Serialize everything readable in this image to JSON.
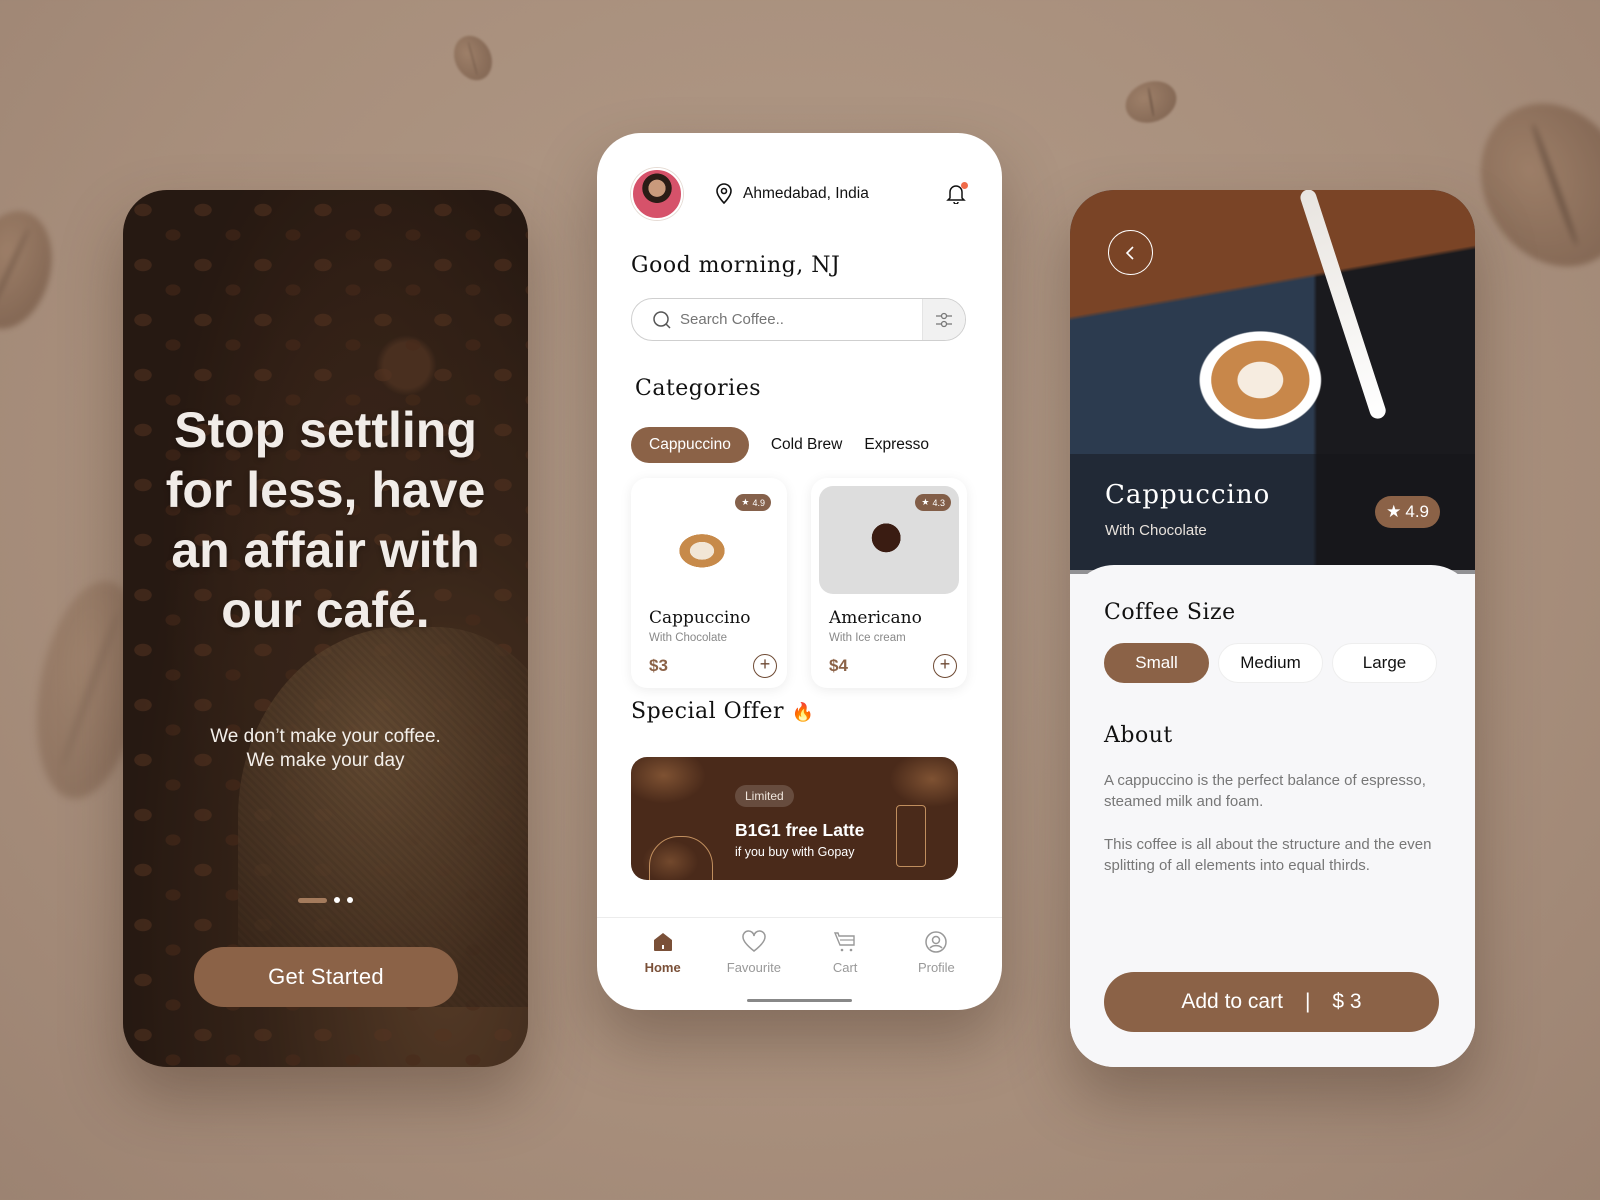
{
  "onboarding": {
    "headline": "Stop settling for less, have an affair with our café.",
    "tagline_line1": "We don’t make your coffee.",
    "tagline_line2": "We make your day",
    "pager": {
      "total": 3,
      "active": 1
    },
    "cta_label": "Get Started"
  },
  "home": {
    "location": "Ahmedabad, India",
    "greeting": "Good morning, NJ",
    "search": {
      "placeholder": "Search Coffee.."
    },
    "categories_title": "Categories",
    "categories": [
      {
        "label": "Cappuccino",
        "active": true
      },
      {
        "label": "Cold Brew",
        "active": false
      },
      {
        "label": "Expresso",
        "active": false
      }
    ],
    "products": [
      {
        "name": "Cappuccino",
        "subtitle": "With Chocolate",
        "price": "$3",
        "rating": "4.9"
      },
      {
        "name": "Americano",
        "subtitle": "With Ice cream",
        "price": "$4",
        "rating": "4.3"
      }
    ],
    "special_offer_title": "Special Offer",
    "special_offer_emoji": "🔥",
    "offer": {
      "badge": "Limited",
      "title": "B1G1 free Latte",
      "subtitle": "if you buy with Gopay"
    },
    "tabs": [
      {
        "label": "Home",
        "icon": "home-icon",
        "active": true
      },
      {
        "label": "Favourite",
        "icon": "heart-icon",
        "active": false
      },
      {
        "label": "Cart",
        "icon": "cart-icon",
        "active": false
      },
      {
        "label": "Profile",
        "icon": "profile-icon",
        "active": false
      }
    ]
  },
  "detail": {
    "title": "Cappuccino",
    "subtitle": "With Chocolate",
    "rating": "4.9",
    "size_title": "Coffee Size",
    "sizes": [
      {
        "label": "Small",
        "active": true
      },
      {
        "label": "Medium",
        "active": false
      },
      {
        "label": "Large",
        "active": false
      }
    ],
    "about_title": "About",
    "about_p1": "A cappuccino is the perfect balance of espresso, steamed milk and foam.",
    "about_p2": "This coffee is all about the structure and the even splitting of all elements into equal thirds.",
    "cart_label": "Add to cart",
    "cart_separator": "|",
    "cart_price": "$ 3"
  },
  "colors": {
    "accent": "#8b6247",
    "background": "#a88f7c",
    "offer_bg": "#4a2a1a"
  }
}
